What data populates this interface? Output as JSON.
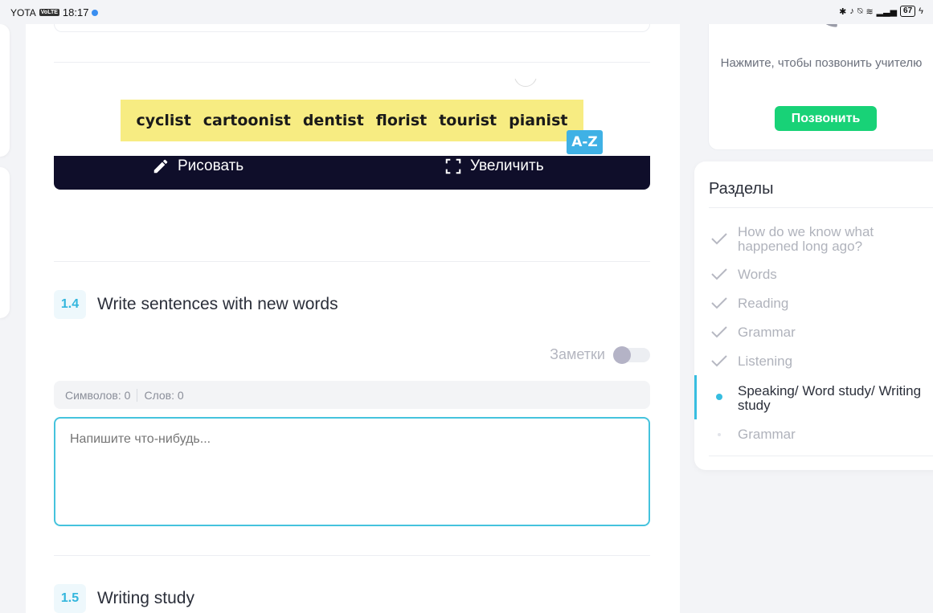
{
  "status_bar": {
    "carrier": "YOTA",
    "network_badge": "VoLTE",
    "time": "18:17",
    "battery": "67"
  },
  "image_words": [
    "cyclist",
    "cartoonist",
    "dentist",
    "florist",
    "tourist",
    "pianist"
  ],
  "image_badge": "A-Z",
  "toolbar": {
    "draw_label": "Рисовать",
    "zoom_label": "Увеличить"
  },
  "exercise_1_4": {
    "number": "1.4",
    "title": "Write sentences with new words"
  },
  "notes": {
    "label": "Заметки",
    "toggle_on": false
  },
  "counter": {
    "symbols_label": "Символов:",
    "symbols_value": "0",
    "words_label": "Слов:",
    "words_value": "0"
  },
  "editor": {
    "placeholder": "Напишите что-нибудь..."
  },
  "exercise_1_5": {
    "number": "1.5",
    "title": "Writing study"
  },
  "call_card": {
    "text": "Нажмите, чтобы позвонить учителю",
    "button_label": "Позвонить"
  },
  "sections": {
    "title": "Разделы",
    "items": [
      {
        "label": "How do we know what happened long ago?",
        "state": "done"
      },
      {
        "label": "Words",
        "state": "done"
      },
      {
        "label": "Reading",
        "state": "done"
      },
      {
        "label": "Grammar",
        "state": "done"
      },
      {
        "label": "Listening",
        "state": "done"
      },
      {
        "label": "Speaking/ Word study/ Writing study",
        "state": "active"
      },
      {
        "label": "Grammar",
        "state": "pending"
      }
    ]
  },
  "colors": {
    "accent": "#37bde0",
    "call_green": "#18d277",
    "toolbar_dark": "#0f0e2a",
    "highlight_yellow": "#f7ec82"
  }
}
